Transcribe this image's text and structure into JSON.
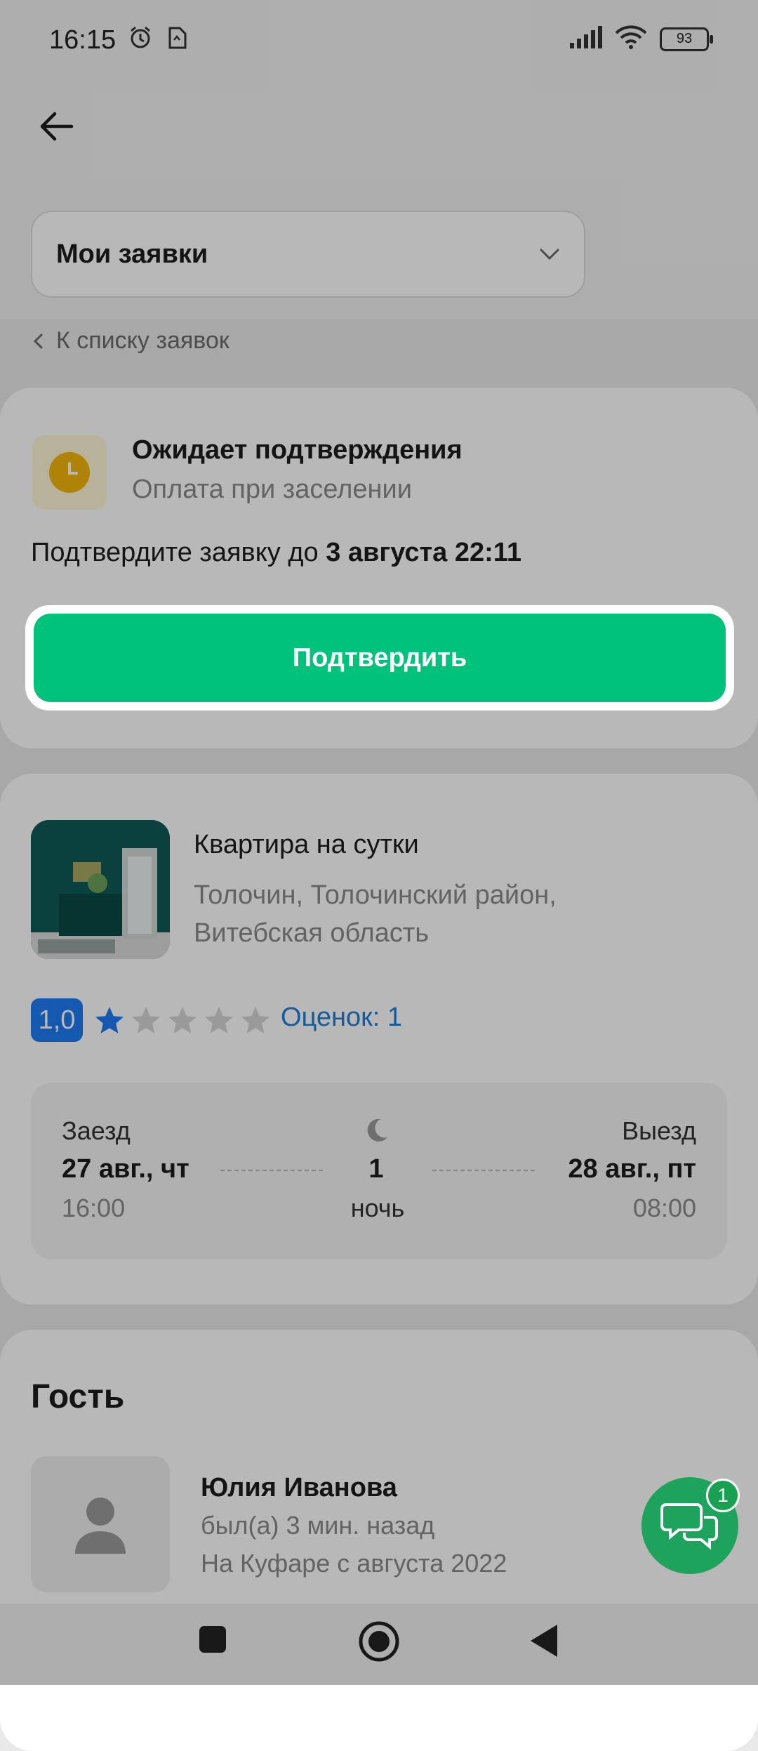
{
  "status_bar": {
    "time": "16:15",
    "battery": "93"
  },
  "header": {
    "dropdown_label": "Мои заявки",
    "back_link": "К списку заявок"
  },
  "booking_status": {
    "title": "Ожидает подтверждения",
    "subtitle": "Оплата при заселении",
    "confirm_prefix": "Подтвердите заявку до ",
    "confirm_deadline": "3 августа 22:11",
    "confirm_button": "Подтвердить"
  },
  "listing": {
    "title": "Квартира на сутки",
    "address_line1": "Толочин, Толочинский район,",
    "address_line2": "Витебская область",
    "rating": "1,0",
    "stars_filled": 1,
    "stars_total": 5,
    "reviews": "Оценок: 1"
  },
  "dates": {
    "checkin_label": "Заезд",
    "checkin_date": "27 авг., чт",
    "checkin_time": "16:00",
    "nights_count": "1",
    "nights_label": "ночь",
    "checkout_label": "Выезд",
    "checkout_date": "28 авг., пт",
    "checkout_time": "08:00"
  },
  "guest": {
    "heading": "Гость",
    "name": "Юлия Иванова",
    "last_seen": "был(а) 3 мин. назад",
    "since": "На Куфаре с августа 2022"
  },
  "chat": {
    "badge": "1"
  },
  "colors": {
    "accent_green": "#00c27a",
    "rating_blue": "#1c7cf3",
    "link_blue": "#1b7fd8",
    "pending_yellow": "#f3b60b"
  }
}
